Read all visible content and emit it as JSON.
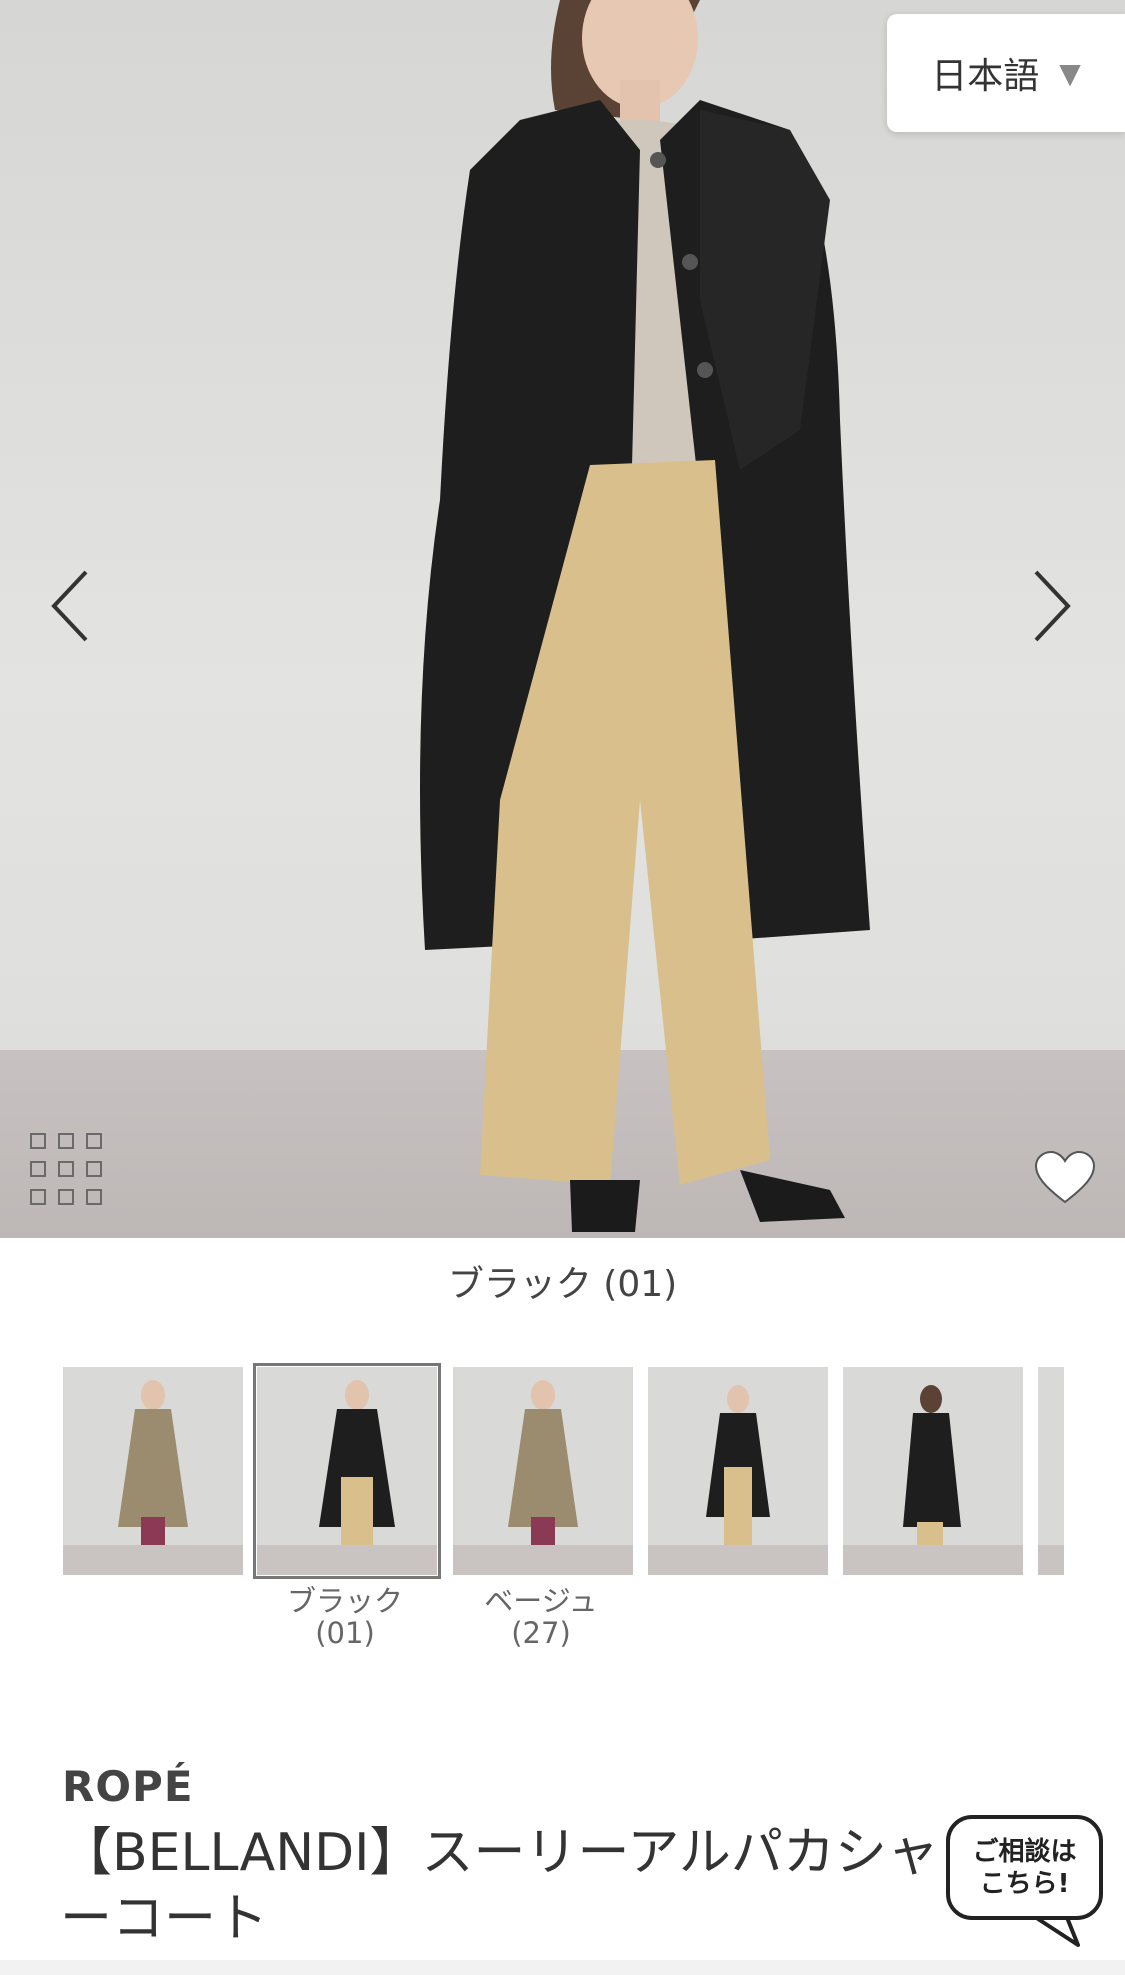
{
  "language_selector": {
    "value": "日本語"
  },
  "gallery": {
    "current_color_caption": "ブラック (01)"
  },
  "thumbnails": [
    {
      "coat": "beige",
      "label_name": "",
      "label_code": ""
    },
    {
      "coat": "black",
      "label_name": "ブラック",
      "label_code": "(01)",
      "selected": true
    },
    {
      "coat": "beige",
      "label_name": "ベージュ",
      "label_code": "(27)"
    },
    {
      "coat": "black",
      "label_name": "",
      "label_code": ""
    },
    {
      "coat": "black",
      "label_name": "",
      "label_code": ""
    }
  ],
  "product": {
    "brand": "ROPÉ",
    "name_line1": "【BELLANDI】スーリーアルパカシャ",
    "name_line2": "ーコート"
  },
  "chat_button": {
    "line1": "ご相談は",
    "line2": "こちら!"
  },
  "colors": {
    "coat_black": "#1e1e1e",
    "coat_beige": "#9b8c70",
    "pants_beige": "#d8bf8c",
    "pants_berry": "#8a3a54",
    "sweater": "#cfc6bc"
  }
}
